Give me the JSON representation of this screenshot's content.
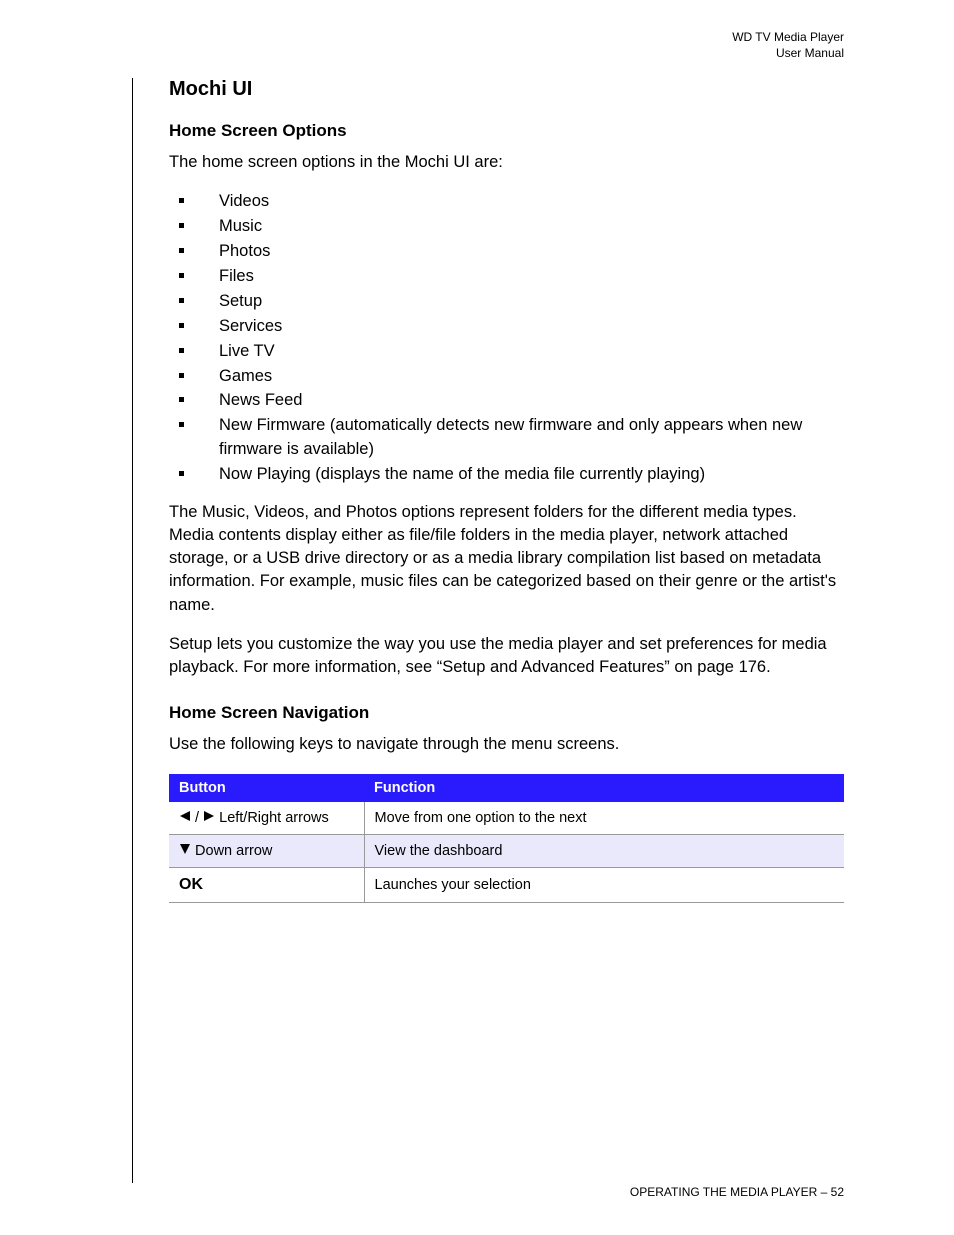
{
  "header": {
    "line1": "WD TV Media Player",
    "line2": "User Manual"
  },
  "section_title": "Mochi UI",
  "home_options": {
    "heading": "Home Screen Options",
    "intro": "The home screen options in the Mochi UI are:",
    "items": [
      "Videos",
      "Music",
      "Photos",
      "Files",
      "Setup",
      "Services",
      "Live TV",
      "Games",
      "News Feed",
      "New Firmware (automatically detects new firmware and only appears when new firmware is available)",
      "Now Playing (displays the name of the media file currently playing)"
    ],
    "para1": "The Music, Videos, and Photos options represent folders for the different media types. Media contents display either as file/file folders in the media player, network attached storage, or a USB drive directory or as a media library compilation list based on metadata information. For example, music files can be categorized based on their genre or the artist's name.",
    "para2": "Setup lets you customize the way you use the media player and set preferences for media playback. For more information, see “Setup and Advanced Features” on page 176."
  },
  "nav": {
    "heading": "Home Screen Navigation",
    "intro": "Use the following keys to navigate through the menu screens.",
    "col1": "Button",
    "col2": "Function",
    "rows": [
      {
        "button_text": " Left/Right arrows",
        "function": "Move from one option to the next"
      },
      {
        "button_text": " Down arrow",
        "function": "View the dashboard"
      },
      {
        "button_text": "OK",
        "function": "Launches your selection"
      }
    ]
  },
  "footer": {
    "label": "OPERATING THE MEDIA PLAYER",
    "sep": " – ",
    "page": "52"
  }
}
